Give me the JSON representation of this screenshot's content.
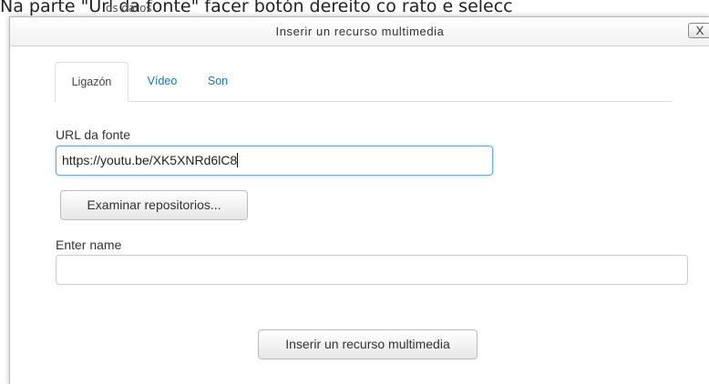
{
  "background_caption": {
    "text": "Na parte \"Url da fonte\" facer botón dereito co rato e selecc",
    "fragment": "os datos"
  },
  "dialog": {
    "title": "Inserir un recurso multimedia",
    "close_label": "X"
  },
  "tabs": [
    {
      "label": "Ligazón",
      "active": true
    },
    {
      "label": "Vídeo",
      "active": false
    },
    {
      "label": "Son",
      "active": false
    }
  ],
  "form": {
    "url_label": "URL da fonte",
    "url_value": "https://youtu.be/XK5XNRd6lC8",
    "browse_button": "Examinar repositorios...",
    "name_label": "Enter name",
    "name_value": ""
  },
  "footer": {
    "insert_button": "Inserir un recurso multimedia"
  },
  "colors": {
    "link": "#1177bb",
    "focus_border": "#66a7e2"
  }
}
